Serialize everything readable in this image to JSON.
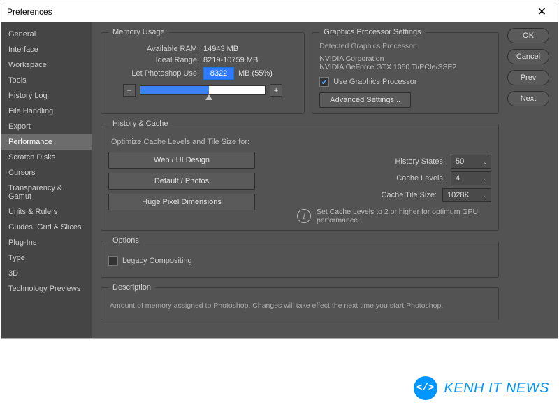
{
  "window": {
    "title": "Preferences"
  },
  "sidebar": {
    "items": [
      "General",
      "Interface",
      "Workspace",
      "Tools",
      "History Log",
      "File Handling",
      "Export",
      "Performance",
      "Scratch Disks",
      "Cursors",
      "Transparency & Gamut",
      "Units & Rulers",
      "Guides, Grid & Slices",
      "Plug-Ins",
      "Type",
      "3D",
      "Technology Previews"
    ],
    "activeIndex": 7
  },
  "actions": {
    "ok": "OK",
    "cancel": "Cancel",
    "prev": "Prev",
    "next": "Next"
  },
  "memory": {
    "title": "Memory Usage",
    "availableLabel": "Available RAM:",
    "availableValue": "14943 MB",
    "idealLabel": "Ideal Range:",
    "idealValue": "8219-10759 MB",
    "letUseLabel": "Let Photoshop Use:",
    "letUseValue": "8322",
    "letUseSuffix": "MB (55%)",
    "sliderPercent": 55,
    "minus": "−",
    "plus": "+"
  },
  "gpu": {
    "title": "Graphics Processor Settings",
    "detectedLabel": "Detected Graphics Processor:",
    "line1": "NVIDIA Corporation",
    "line2": "NVIDIA GeForce GTX 1050 Ti/PCIe/SSE2",
    "useLabel": "Use Graphics Processor",
    "useChecked": true,
    "advanced": "Advanced Settings..."
  },
  "historyCache": {
    "title": "History & Cache",
    "subtitle": "Optimize Cache Levels and Tile Size for:",
    "presets": [
      "Web / UI Design",
      "Default / Photos",
      "Huge Pixel Dimensions"
    ],
    "historyStatesLabel": "History States:",
    "historyStatesValue": "50",
    "cacheLevelsLabel": "Cache Levels:",
    "cacheLevelsValue": "4",
    "cacheTileLabel": "Cache Tile Size:",
    "cacheTileValue": "1028K",
    "infoText": "Set Cache Levels to 2 or higher for optimum GPU performance."
  },
  "options": {
    "title": "Options",
    "legacyLabel": "Legacy Compositing",
    "legacyChecked": false
  },
  "description": {
    "title": "Description",
    "text": "Amount of memory assigned to Photoshop. Changes will take effect the next time you start Photoshop."
  },
  "watermark": {
    "logoText": "</>",
    "text": "KENH IT NEWS"
  }
}
